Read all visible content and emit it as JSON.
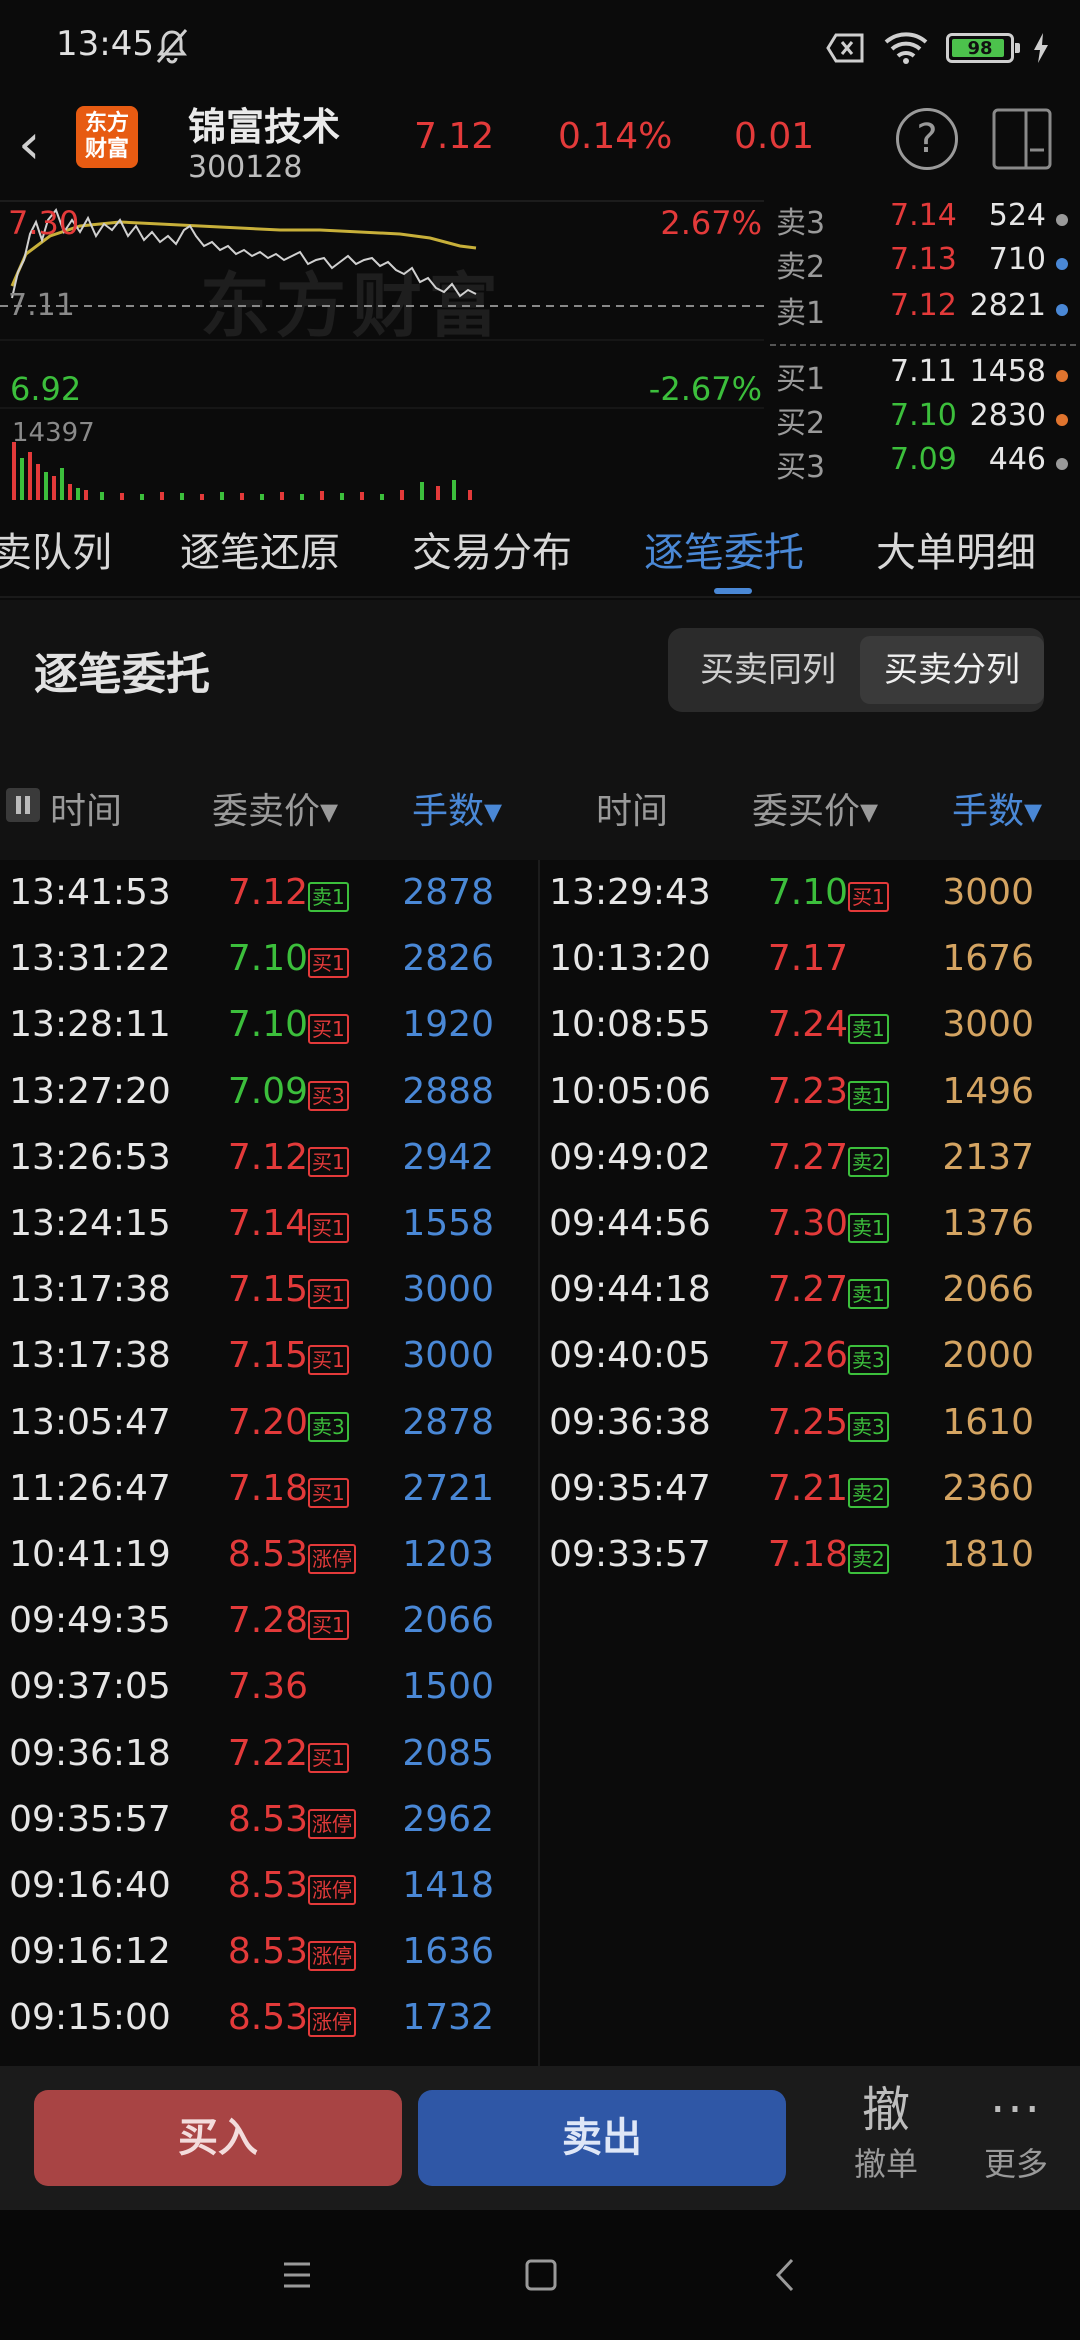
{
  "status": {
    "time": "13:45",
    "battery": "98"
  },
  "header": {
    "logo": [
      "东方",
      "财富"
    ],
    "name": "锦富技术",
    "code": "300128",
    "price": "7.12",
    "pct": "0.14%",
    "change": "0.01"
  },
  "chart": {
    "watermark": "东方财富",
    "high_label": "7.30",
    "mid_label": "7.11",
    "low_label": "6.92",
    "up_pct": "2.67%",
    "down_pct": "-2.67%",
    "volume_label": "14397"
  },
  "book": [
    {
      "label": "卖3",
      "price": "7.14",
      "qty": "524",
      "price_color": "red",
      "dot": "#9a9a9a"
    },
    {
      "label": "卖2",
      "price": "7.13",
      "qty": "710",
      "price_color": "red",
      "dot": "#4a88d6"
    },
    {
      "label": "卖1",
      "price": "7.12",
      "qty": "2821",
      "price_color": "red",
      "dot": "#4a88d6"
    },
    {
      "label": "买1",
      "price": "7.11",
      "qty": "1458",
      "price_color": "white",
      "dot": "#e0742e"
    },
    {
      "label": "买2",
      "price": "7.10",
      "qty": "2830",
      "price_color": "green",
      "dot": "#e0742e"
    },
    {
      "label": "买3",
      "price": "7.09",
      "qty": "446",
      "price_color": "green",
      "dot": "#9a9a9a"
    }
  ],
  "tabs": [
    "卖队列",
    "逐笔还原",
    "交易分布",
    "逐笔委托",
    "大单明细"
  ],
  "section": {
    "title": "逐笔委托",
    "toggle_a": "买卖同列",
    "toggle_b": "买卖分列"
  },
  "columns": {
    "left": {
      "time": "时间",
      "price": "委卖价▾",
      "qty": "手数▾"
    },
    "right": {
      "time": "时间",
      "price": "委买价▾",
      "qty": "手数▾"
    }
  },
  "sell_orders": [
    {
      "time": "13:41:53",
      "price": "7.12",
      "pc": "red",
      "tag": "卖1",
      "tc": "green",
      "qty": "2878"
    },
    {
      "time": "13:31:22",
      "price": "7.10",
      "pc": "green",
      "tag": "买1",
      "tc": "red",
      "qty": "2826"
    },
    {
      "time": "13:28:11",
      "price": "7.10",
      "pc": "green",
      "tag": "买1",
      "tc": "red",
      "qty": "1920"
    },
    {
      "time": "13:27:20",
      "price": "7.09",
      "pc": "green",
      "tag": "买3",
      "tc": "red",
      "qty": "2888"
    },
    {
      "time": "13:26:53",
      "price": "7.12",
      "pc": "red",
      "tag": "买1",
      "tc": "red",
      "qty": "2942"
    },
    {
      "time": "13:24:15",
      "price": "7.14",
      "pc": "red",
      "tag": "买1",
      "tc": "red",
      "qty": "1558"
    },
    {
      "time": "13:17:38",
      "price": "7.15",
      "pc": "red",
      "tag": "买1",
      "tc": "red",
      "qty": "3000"
    },
    {
      "time": "13:17:38",
      "price": "7.15",
      "pc": "red",
      "tag": "买1",
      "tc": "red",
      "qty": "3000"
    },
    {
      "time": "13:05:47",
      "price": "7.20",
      "pc": "red",
      "tag": "卖3",
      "tc": "green",
      "qty": "2878"
    },
    {
      "time": "11:26:47",
      "price": "7.18",
      "pc": "red",
      "tag": "买1",
      "tc": "red",
      "qty": "2721"
    },
    {
      "time": "10:41:19",
      "price": "8.53",
      "pc": "red",
      "tag": "涨停",
      "tc": "red",
      "qty": "1203"
    },
    {
      "time": "09:49:35",
      "price": "7.28",
      "pc": "red",
      "tag": "买1",
      "tc": "red",
      "qty": "2066"
    },
    {
      "time": "09:37:05",
      "price": "7.36",
      "pc": "red",
      "tag": "",
      "tc": "red",
      "qty": "1500"
    },
    {
      "time": "09:36:18",
      "price": "7.22",
      "pc": "red",
      "tag": "买1",
      "tc": "red",
      "qty": "2085"
    },
    {
      "time": "09:35:57",
      "price": "8.53",
      "pc": "red",
      "tag": "涨停",
      "tc": "red",
      "qty": "2962"
    },
    {
      "time": "09:16:40",
      "price": "8.53",
      "pc": "red",
      "tag": "涨停",
      "tc": "red",
      "qty": "1418"
    },
    {
      "time": "09:16:12",
      "price": "8.53",
      "pc": "red",
      "tag": "涨停",
      "tc": "red",
      "qty": "1636"
    },
    {
      "time": "09:15:00",
      "price": "8.53",
      "pc": "red",
      "tag": "涨停",
      "tc": "red",
      "qty": "1732"
    }
  ],
  "buy_orders": [
    {
      "time": "13:29:43",
      "price": "7.10",
      "pc": "green",
      "tag": "买1",
      "tc": "red",
      "qty": "3000"
    },
    {
      "time": "10:13:20",
      "price": "7.17",
      "pc": "red",
      "tag": "",
      "tc": "red",
      "qty": "1676"
    },
    {
      "time": "10:08:55",
      "price": "7.24",
      "pc": "red",
      "tag": "卖1",
      "tc": "green",
      "qty": "3000"
    },
    {
      "time": "10:05:06",
      "price": "7.23",
      "pc": "red",
      "tag": "卖1",
      "tc": "green",
      "qty": "1496"
    },
    {
      "time": "09:49:02",
      "price": "7.27",
      "pc": "red",
      "tag": "卖2",
      "tc": "green",
      "qty": "2137"
    },
    {
      "time": "09:44:56",
      "price": "7.30",
      "pc": "red",
      "tag": "卖1",
      "tc": "green",
      "qty": "1376"
    },
    {
      "time": "09:44:18",
      "price": "7.27",
      "pc": "red",
      "tag": "卖1",
      "tc": "green",
      "qty": "2066"
    },
    {
      "time": "09:40:05",
      "price": "7.26",
      "pc": "red",
      "tag": "卖3",
      "tc": "green",
      "qty": "2000"
    },
    {
      "time": "09:36:38",
      "price": "7.25",
      "pc": "red",
      "tag": "卖3",
      "tc": "green",
      "qty": "1610"
    },
    {
      "time": "09:35:47",
      "price": "7.21",
      "pc": "red",
      "tag": "卖2",
      "tc": "green",
      "qty": "2360"
    },
    {
      "time": "09:33:57",
      "price": "7.18",
      "pc": "red",
      "tag": "卖2",
      "tc": "green",
      "qty": "1810"
    }
  ],
  "actions": {
    "buy": "买入",
    "sell": "卖出",
    "cancel_icon": "撤",
    "cancel": "撤单",
    "more_icon": "···",
    "more": "更多"
  }
}
